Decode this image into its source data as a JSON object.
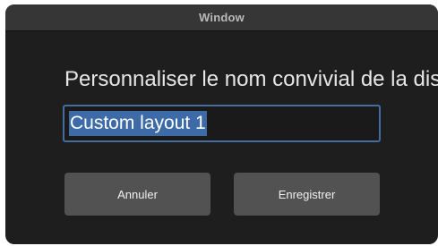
{
  "window": {
    "title": "Window"
  },
  "dialog": {
    "prompt": "Personnaliser le nom convivial de la dispo",
    "name_field": {
      "value": "Custom layout 1"
    },
    "buttons": {
      "cancel_label": "Annuler",
      "save_label": "Enregistrer"
    }
  }
}
